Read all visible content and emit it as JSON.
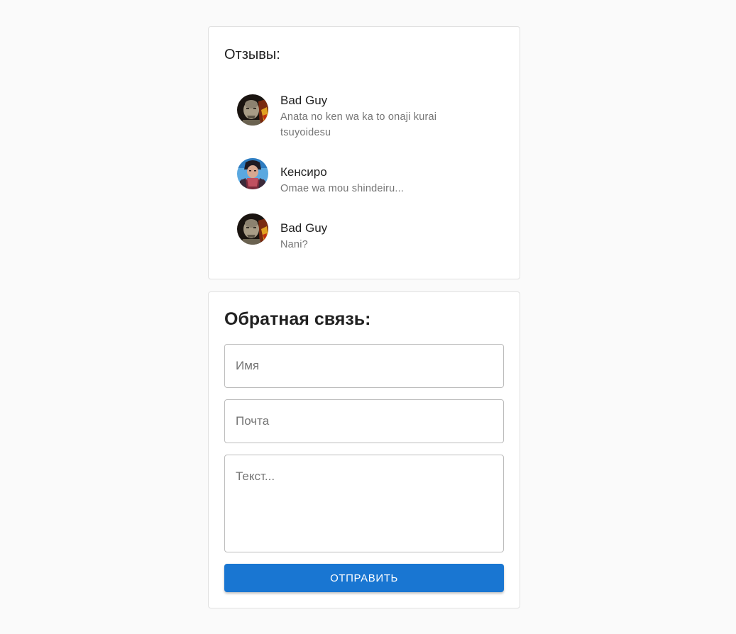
{
  "reviews": {
    "title": "Отзывы:",
    "items": [
      {
        "name": "Bad Guy",
        "text": "Anata no ken wa ka to onaji kurai tsuyoidesu",
        "avatar": "bad-guy-avatar"
      },
      {
        "name": "Кенсиро",
        "text": "Omae wa mou shindeiru...",
        "avatar": "kenshiro-avatar"
      },
      {
        "name": "Bad Guy",
        "text": "Nani?",
        "avatar": "bad-guy-avatar"
      }
    ]
  },
  "feedback": {
    "title": "Обратная связь:",
    "name_placeholder": "Имя",
    "email_placeholder": "Почта",
    "message_placeholder": "Текст...",
    "submit_label": "ОТПРАВИТЬ"
  },
  "colors": {
    "background": "#fafafa",
    "card": "#ffffff",
    "primary": "#1976d2",
    "secondary_text": "#757575"
  }
}
